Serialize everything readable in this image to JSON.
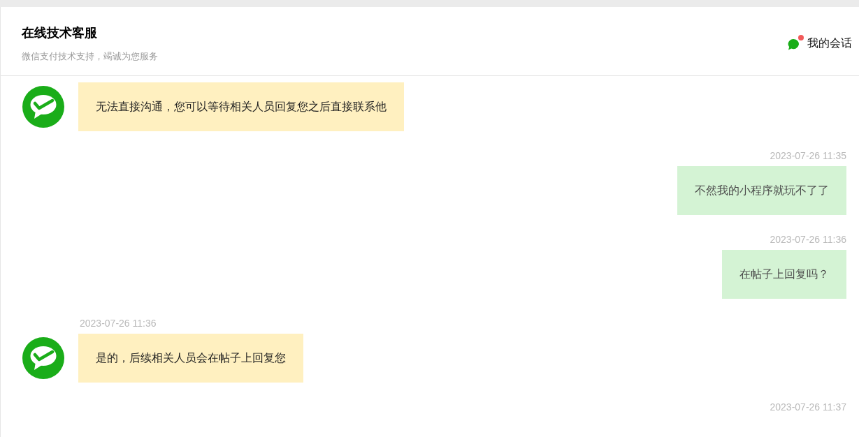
{
  "header": {
    "title": "在线技术客服",
    "subtitle": "微信支付技术支持，竭诚为您服务"
  },
  "sessions_link": {
    "label": "我的会话",
    "unread": true
  },
  "messages": [
    {
      "kind": "agent",
      "text": "无法直接沟通，您可以等待相关人员回复您之后直接联系他"
    },
    {
      "kind": "user",
      "time": "2023-07-26 11:35",
      "text": "不然我的小程序就玩不了了"
    },
    {
      "kind": "user",
      "time": "2023-07-26 11:36",
      "text": "在帖子上回复吗？"
    },
    {
      "kind": "agent",
      "time": "2023-07-26 11:36",
      "text": "是的，后续相关人员会在帖子上回复您"
    },
    {
      "kind": "user",
      "time": "2023-07-26 11:37"
    }
  ]
}
